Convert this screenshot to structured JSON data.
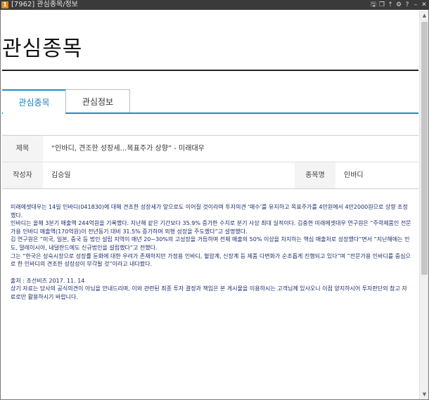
{
  "window": {
    "app_icon_label": "1",
    "title": "[7962] 관심종목/정보",
    "controls": [
      "🖫",
      "❐",
      "⇡",
      "⚙",
      "?",
      "–",
      "✕"
    ]
  },
  "page": {
    "title": "관심종목"
  },
  "tabs": [
    {
      "label": "관심종목",
      "active": true
    },
    {
      "label": "관심정보",
      "active": false
    }
  ],
  "info": {
    "subject_label": "제목",
    "subject_value": "“인바디, 견조한 성장세…목표주가 상향” - 미래대우",
    "author_label": "작성자",
    "author_value": "김승일",
    "stock_label": "종목명",
    "stock_value": "인바디"
  },
  "article": {
    "paragraphs": [
      "미래에셋대우는 14일 인바디(041830)에 대해 견조한 성장세가 앞으로도 이어질 것이라며 투자의견 ‘매수’를 유지하고 목표주가를 4만원에서 4만2000원으로 상향 조정했다.",
      "인바디는 올해 3분기 매출액 244억원을 기록했다. 지난해 같은 기간보다 35.9% 증가한 수치로 분기 사상 최대 실적이다. 김충현 미래에셋대우 연구원은 “주력제품인 전문가용 인바디 매출액(170억원)이 전년동기 대비 31.5% 증가하며 외형 성장을 주도했다”고 설명했다.",
      "김 연구원은 “미국, 일본, 중국 등 법인 설립 지역이 매년 20~30%의 고성장을 거듭하며 전체 매출의 50% 이상을 차지하는 핵심 매출처로 성장했다”면서 “지난해에는 인도, 말레이시아, 네덜란드에도 신규법인을 설립했다”고 전했다.",
      "그는 “한국은 성숙시장으로 성장률 둔화에 대한 우려가 존재하지만 가정용 인바디, 혈압계, 신장계 등 제품 다변화가 순조롭게 진행되고 있다”며 “전문가용 인바디를 중심으로 한 인바디의 견조한 성장성이 부각될 것”이라고 내다봤다."
    ],
    "source": "출처 : 조선비즈 2017. 11. 14",
    "disclaimer": "상기 자료는 당사의 공식의견이 아님을 안내드리며, 이와 관련된 최종 투자 결정과 책임은 본 게시물을 이용하시는 고객님께 있사오니 이점 양지하시어 투자판단의 참고 자료로만 활용하시기 바랍니다."
  },
  "scrollbar": {
    "up": "▲",
    "down": "▼"
  },
  "colors": {
    "accent": "#1a90c8",
    "article_text": "#1c2c6b",
    "titlebar": "#3a3a3a"
  }
}
